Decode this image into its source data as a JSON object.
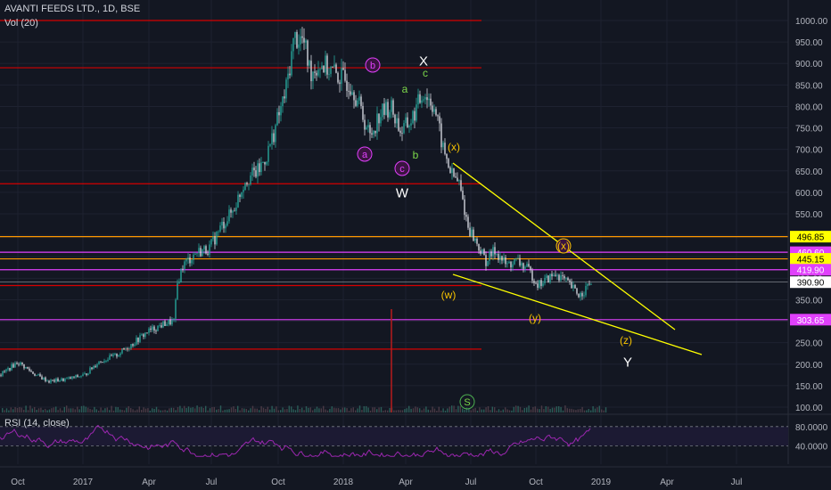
{
  "header": {
    "title": "AVANTI FEEDS LTD., 1D, BSE",
    "volume": "Vol (20)"
  },
  "rsi": {
    "title": "RSI (14, close)",
    "upper": 80,
    "lower": 40,
    "upper_label": "80.0000",
    "lower_label": "40.0000"
  },
  "colors": {
    "background": "#131722",
    "candle_up": "#26a69a",
    "candle_down": "#d1d4dc",
    "level_red": "#d50000",
    "level_orange": "#ff9800",
    "level_magenta": "#e040fb",
    "trend_yellow": "#ffff00",
    "rsi_line": "#9c27b0"
  },
  "chart_data": {
    "type": "line",
    "xlabel": "",
    "ylabel": "",
    "ylim": [
      100,
      1000
    ],
    "x_ticks": [
      "Oct",
      "2017",
      "Apr",
      "Jul",
      "Oct",
      "2018",
      "Apr",
      "Jul",
      "Oct",
      "2019",
      "Apr",
      "Jul"
    ],
    "y_ticks": [
      "1000.00",
      "950.00",
      "900.00",
      "850.00",
      "800.00",
      "750.00",
      "700.00",
      "650.00",
      "600.00",
      "550.00",
      "500.00",
      "450.00",
      "400.00",
      "350.00",
      "300.00",
      "250.00",
      "200.00",
      "150.00",
      "100.00"
    ],
    "price_series": {
      "name": "AVANTI FEEDS LTD.",
      "x": [
        0,
        0.5,
        1,
        1.5,
        2,
        2.5,
        3,
        3.5,
        4,
        4.5,
        5,
        5.5,
        6,
        6.5,
        7,
        7.5,
        8,
        8.5,
        9,
        9.5,
        10,
        10.5,
        11,
        11.5,
        12,
        12.5,
        13,
        13.5,
        14,
        14.5,
        15,
        15.5,
        16,
        16.5,
        17,
        17.5,
        18,
        18.5,
        19,
        19.5,
        20,
        20.5,
        21,
        21.5,
        22,
        22.5,
        23,
        23.5,
        24,
        24.5,
        25,
        25.5,
        26,
        26.5,
        27,
        27.5
      ],
      "values": [
        175,
        180,
        190,
        160,
        165,
        175,
        195,
        215,
        240,
        255,
        290,
        300,
        430,
        460,
        470,
        520,
        560,
        620,
        690,
        760,
        830,
        960,
        950,
        880,
        870,
        850,
        800,
        720,
        760,
        800,
        740,
        820,
        760,
        640,
        520,
        470,
        430,
        460,
        420,
        440,
        390,
        380,
        410,
        390,
        350,
        370
      ]
    },
    "levels": [
      {
        "value": 1000,
        "color": "red"
      },
      {
        "value": 890,
        "color": "red"
      },
      {
        "value": 620,
        "color": "red"
      },
      {
        "value": 496.85,
        "color": "orange",
        "label": "496.85"
      },
      {
        "value": 460.6,
        "color": "magenta",
        "label": "460.60"
      },
      {
        "value": 445.15,
        "color": "orange",
        "label": "445.15"
      },
      {
        "value": 419.9,
        "color": "magenta",
        "label": "419.90"
      },
      {
        "value": 390.9,
        "color": "white",
        "label": "390.90"
      },
      {
        "value": 383,
        "color": "red"
      },
      {
        "value": 303.65,
        "color": "magenta",
        "label": "303.65"
      },
      {
        "value": 235,
        "color": "red"
      }
    ],
    "annotations": [
      {
        "text": "(b)",
        "style": "circle-magenta"
      },
      {
        "text": "X",
        "style": "white"
      },
      {
        "text": "c",
        "style": "green"
      },
      {
        "text": "a",
        "style": "green"
      },
      {
        "text": "b",
        "style": "green"
      },
      {
        "text": "(a)",
        "style": "circle-magenta"
      },
      {
        "text": "(c)",
        "style": "circle-magenta"
      },
      {
        "text": "W",
        "style": "white"
      },
      {
        "text": "(x)",
        "style": "orange"
      },
      {
        "text": "(x)",
        "style": "orange-circle"
      },
      {
        "text": "(w)",
        "style": "orange"
      },
      {
        "text": "(y)",
        "style": "orange"
      },
      {
        "text": "(z)",
        "style": "orange"
      },
      {
        "text": "Y",
        "style": "white"
      },
      {
        "text": "S",
        "style": "green-circle"
      }
    ]
  }
}
